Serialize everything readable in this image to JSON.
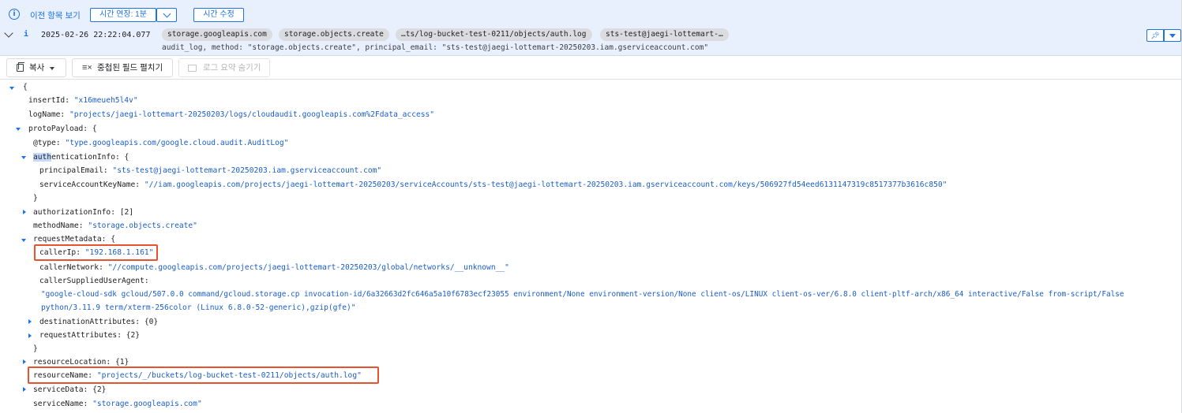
{
  "top_bar": {
    "prev_link": "이전 항목 보기",
    "extend_label": "시간 연장: 1분",
    "edit_time": "시간 수정"
  },
  "log_row": {
    "timestamp": "2025-02-26 22:22:04.077",
    "severity_icon": "info-icon",
    "chips": [
      "storage.googleapis.com",
      "storage.objects.create",
      "…ts/log-bucket-test-0211/objects/auth.log",
      "sts-test@jaegi-lottemart-…"
    ],
    "summary": "audit_log, method: \"storage.objects.create\", principal_email: \"sts-test@jaegi-lottemart-20250203.iam.gserviceaccount.com\""
  },
  "toolbar": {
    "copy_label": "복사",
    "expand_label": "중첩된 필드 펼치기",
    "hide_summary_label": "로그 요약 숨기기"
  },
  "json": {
    "open_brace": "{",
    "insertId_key": "insertId:",
    "insertId_val": "\"x16meueh5l4v\"",
    "logName_key": "logName:",
    "logName_val": "\"projects/jaegi-lottemart-20250203/logs/cloudaudit.googleapis.com%2Fdata_access\"",
    "protoPayload_key": "protoPayload: {",
    "type_key": "@type:",
    "type_val": "\"type.googleapis.com/google.cloud.audit.AuditLog\"",
    "auth_key_hl": "auth",
    "auth_key_rest": "enticationInfo: {",
    "principalEmail_key": "principalEmail:",
    "principalEmail_val": "\"sts-test@jaegi-lottemart-20250203.iam.gserviceaccount.com\"",
    "saKey_key": "serviceAccountKeyName:",
    "saKey_val": "\"//iam.googleapis.com/projects/jaegi-lottemart-20250203/serviceAccounts/sts-test@jaegi-lottemart-20250203.iam.gserviceaccount.com/keys/506927fd54eed6131147319c8517377b3616c850\"",
    "close_brace": "}",
    "authorizationInfo": "authorizationInfo: [2]",
    "methodName_key": "methodName:",
    "methodName_val": "\"storage.objects.create\"",
    "requestMetadata_key": "requestMetadata: {",
    "callerIp_key": "callerIp:",
    "callerIp_val": "\"192.168.1.161\"",
    "callerNetwork_key": "callerNetwork:",
    "callerNetwork_val": "\"//compute.googleapis.com/projects/jaegi-lottemart-20250203/global/networks/__unknown__\"",
    "callerUA_key": "callerSuppliedUserAgent:",
    "callerUA_line1": "\"google-cloud-sdk gcloud/507.0.0 command/gcloud.storage.cp invocation-id/6a32663d2fc646a5a10f6783ecf23055 environment/None environment-version/None client-os/LINUX client-os-ver/6.8.0 client-pltf-arch/x86_64 interactive/False from-script/False",
    "callerUA_line2": "python/3.11.9 term/xterm-256color (Linux 6.8.0-52-generic),gzip(gfe)\"",
    "destinationAttributes": "destinationAttributes: {0}",
    "requestAttributes": "requestAttributes: {2}",
    "resourceLocation": "resourceLocation: {1}",
    "resourceName_key": "resourceName:",
    "resourceName_val": "\"projects/_/buckets/log-bucket-test-0211/objects/auth.log\"",
    "serviceData": "serviceData: {2}",
    "serviceName_key": "serviceName:",
    "serviceName_val": "\"storage.googleapis.com\""
  },
  "colors": {
    "accent": "#1a73e8",
    "highlight_box": "#e8532f",
    "top_bar_bg": "#e8f0fe",
    "value_text": "#1a5ec9"
  }
}
